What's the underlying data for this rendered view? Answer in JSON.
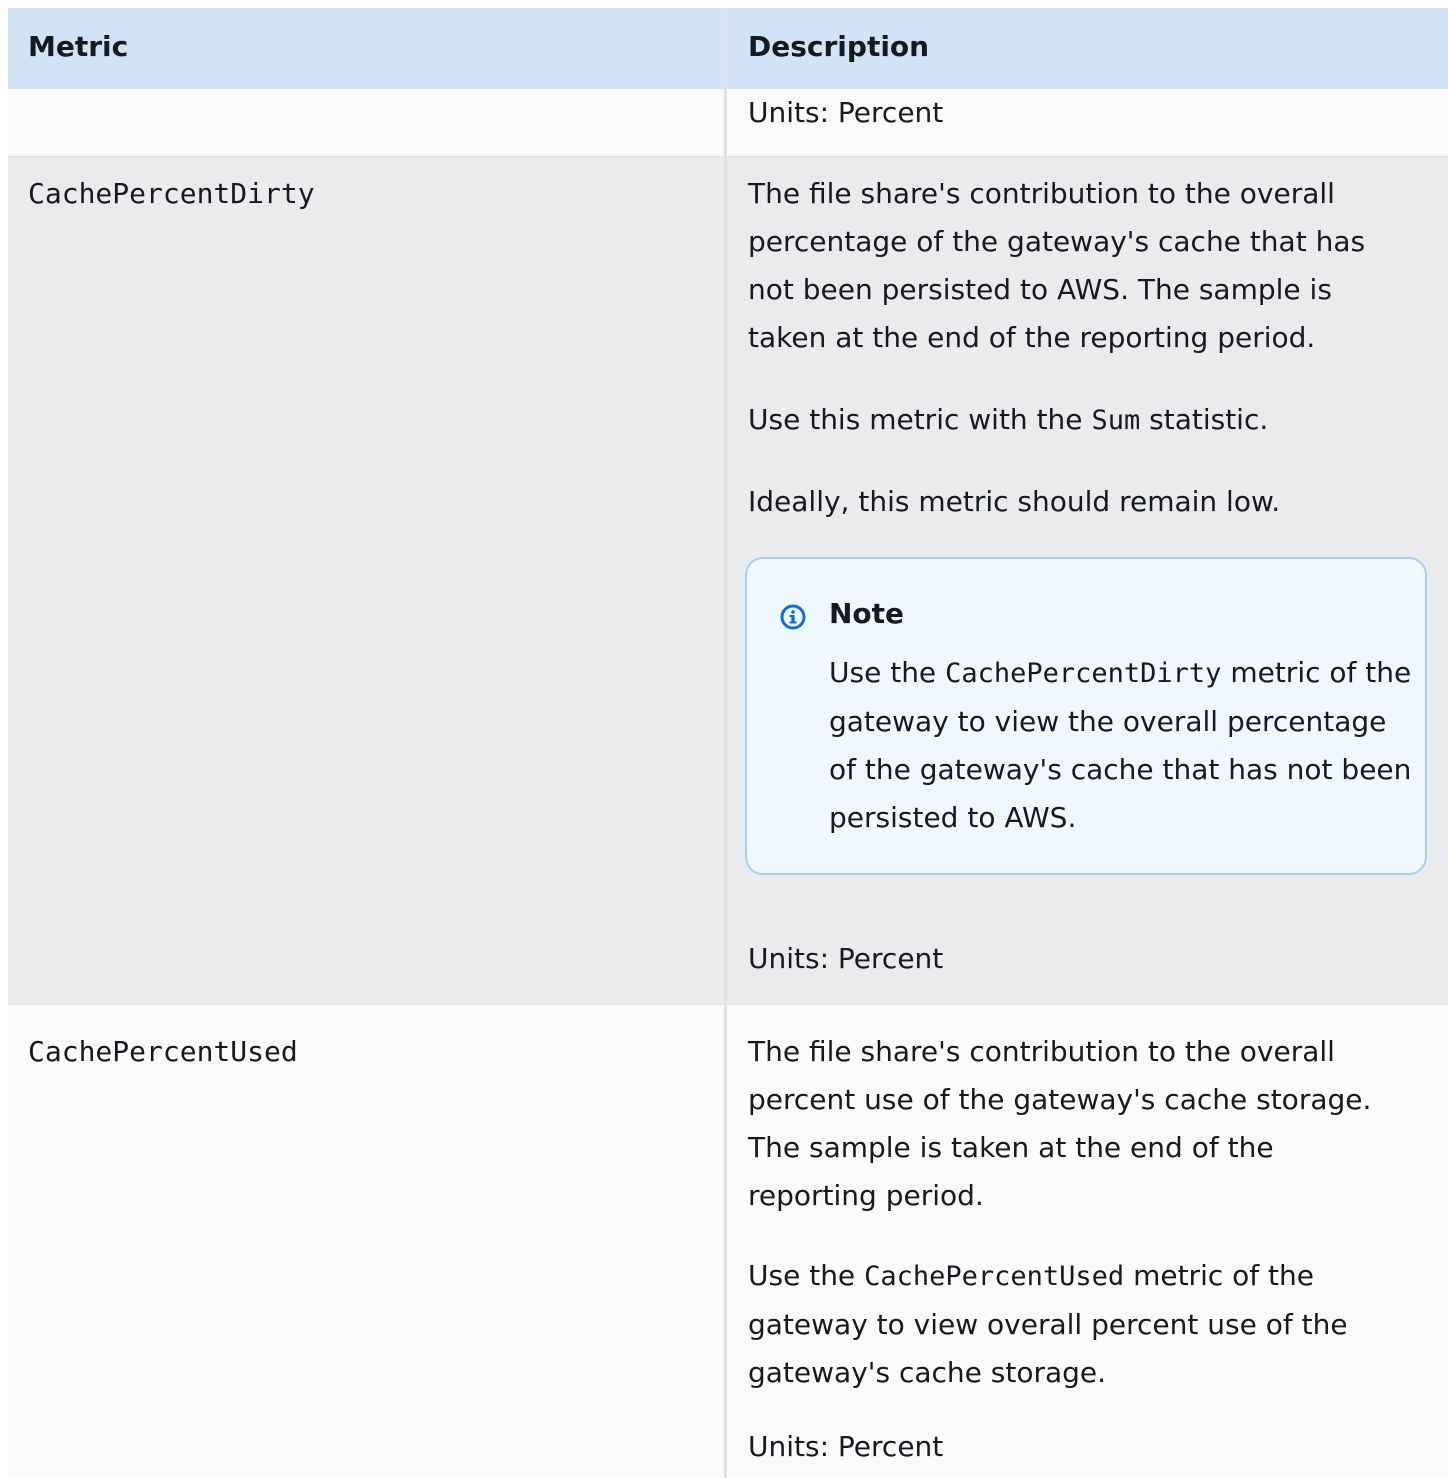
{
  "table": {
    "headers": {
      "metric": "Metric",
      "description": "Description"
    },
    "rows": [
      {
        "metric": "",
        "units": "Units: Percent"
      },
      {
        "metric": "CachePercentDirty",
        "description": "The file share's contribution to the overall percentage of the gateway's cache that has not been persisted to AWS. The sample is taken at the end of the reporting period.",
        "use_prefix": "Use this metric with the",
        "use_code": "Sum",
        "use_suffix": "statistic.",
        "ideal": "Ideally, this metric should remain low.",
        "note": {
          "icon": "info-icon",
          "title": "Note",
          "prefix": "Use the",
          "code": "CachePercentDirty",
          "suffix": "metric of the gateway to view the overall percentage of the gateway's cache that has not been persisted to AWS."
        },
        "units": "Units: Percent"
      },
      {
        "metric": "CachePercentUsed",
        "description": "The file share's contribution to the overall percent use of the gateway's cache storage. The sample is taken at the end of the reporting period.",
        "use_prefix": "Use the",
        "use_code": "CachePercentUsed",
        "use_suffix": "metric of the gateway to view overall percent use of the gateway's cache storage.",
        "units": "Units: Percent"
      }
    ]
  },
  "colors": {
    "header_bg": "#d1e4f7",
    "row_light": "#fafafa",
    "row_dark": "#eaebed",
    "note_bg": "#f0f7fd",
    "note_border": "#a6d0f2",
    "info_icon": "#0972d3"
  }
}
